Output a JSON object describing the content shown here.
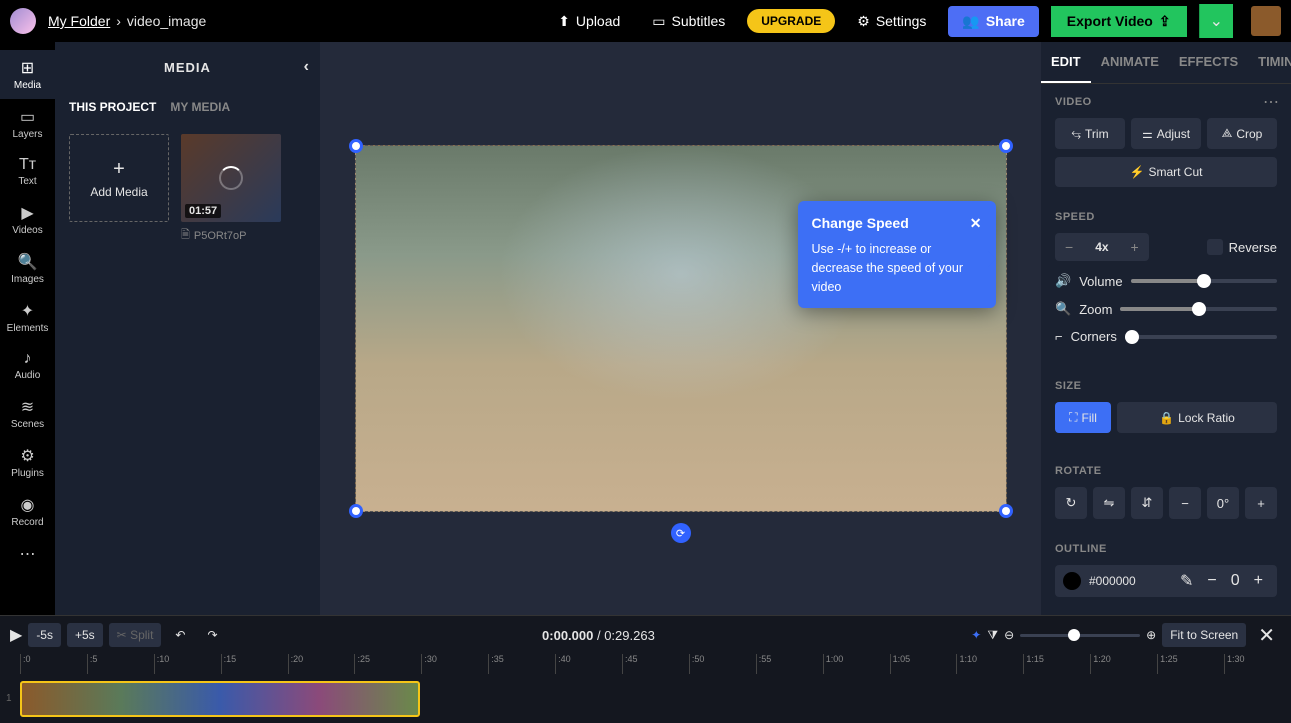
{
  "breadcrumb": {
    "folder": "My Folder",
    "sep": "›",
    "file": "video_image"
  },
  "topbar": {
    "upload": "Upload",
    "subtitles": "Subtitles",
    "upgrade": "UPGRADE",
    "settings": "Settings",
    "share": "Share",
    "export": "Export Video"
  },
  "vnav": [
    {
      "label": "Media",
      "icon": "⊞"
    },
    {
      "label": "Layers",
      "icon": "▭"
    },
    {
      "label": "Text",
      "icon": "Tᴛ"
    },
    {
      "label": "Videos",
      "icon": "▶"
    },
    {
      "label": "Images",
      "icon": "🔍"
    },
    {
      "label": "Elements",
      "icon": "✦"
    },
    {
      "label": "Audio",
      "icon": "♪"
    },
    {
      "label": "Scenes",
      "icon": "≋"
    },
    {
      "label": "Plugins",
      "icon": "⚙"
    },
    {
      "label": "Record",
      "icon": "◉"
    },
    {
      "label": "",
      "icon": "⋯"
    }
  ],
  "media": {
    "title": "MEDIA",
    "tabs": [
      "THIS PROJECT",
      "MY MEDIA"
    ],
    "addLabel": "Add Media",
    "thumb": {
      "duration": "01:57",
      "name": "P5ORt7oP"
    }
  },
  "tooltip": {
    "title": "Change Speed",
    "body": "Use -/+ to increase or decrease the speed of your video"
  },
  "panelTabs": [
    "EDIT",
    "ANIMATE",
    "EFFECTS",
    "TIMING"
  ],
  "sections": {
    "video": "VIDEO",
    "speed": "SPEED",
    "size": "SIZE",
    "rotate": "ROTATE",
    "outline": "OUTLINE"
  },
  "buttons": {
    "trim": "Trim",
    "adjust": "Adjust",
    "crop": "Crop",
    "smartcut": "Smart Cut",
    "reverse": "Reverse",
    "volume": "Volume",
    "zoom": "Zoom",
    "corners": "Corners",
    "fill": "Fill",
    "lockratio": "Lock Ratio"
  },
  "speed": {
    "value": "4x"
  },
  "rotate": {
    "degrees": "0°"
  },
  "outline": {
    "color": "#000000",
    "width": "0"
  },
  "timeline": {
    "back": "-5s",
    "fwd": "+5s",
    "split": "Split",
    "current": "0:00.000",
    "total": "0:29.263",
    "sep": " / ",
    "fit": "Fit to Screen",
    "ticks": [
      ":0",
      ":5",
      ":10",
      ":15",
      ":20",
      ":25",
      ":30",
      ":35",
      ":40",
      ":45",
      ":50",
      ":55",
      "1:00",
      "1:05",
      "1:10",
      "1:15",
      "1:20",
      "1:25",
      "1:30"
    ],
    "row": "1"
  }
}
